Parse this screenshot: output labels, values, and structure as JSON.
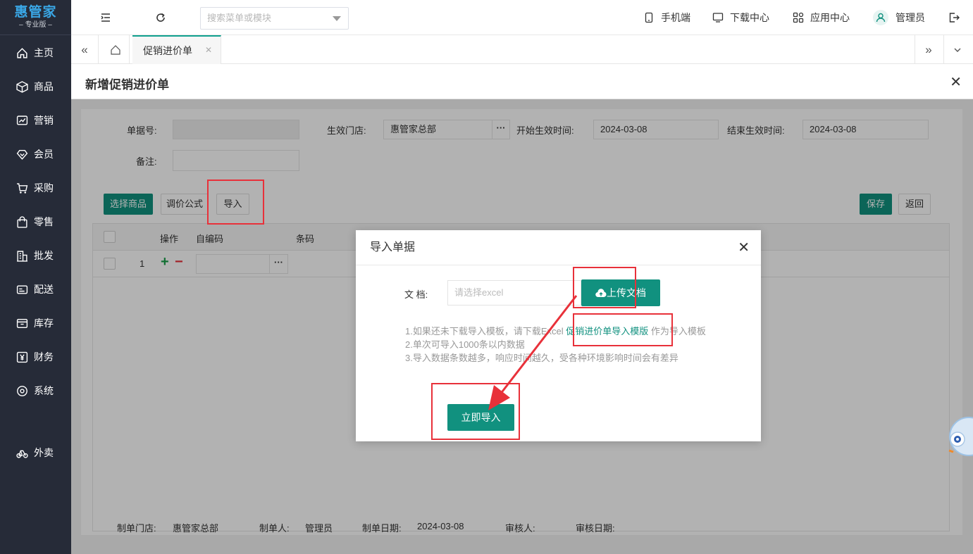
{
  "app": {
    "logo": "惠管家",
    "edition": "专业版"
  },
  "sidebar": {
    "items": [
      {
        "label": "主页"
      },
      {
        "label": "商品"
      },
      {
        "label": "营销"
      },
      {
        "label": "会员"
      },
      {
        "label": "采购"
      },
      {
        "label": "零售"
      },
      {
        "label": "批发"
      },
      {
        "label": "配送"
      },
      {
        "label": "库存"
      },
      {
        "label": "财务"
      },
      {
        "label": "系统"
      },
      {
        "label": "外卖"
      }
    ]
  },
  "topbar": {
    "search_placeholder": "搜索菜单或模块",
    "links": {
      "mobile": "手机端",
      "download": "下载中心",
      "apps": "应用中心",
      "user": "管理员"
    }
  },
  "tabs": {
    "active": "促销进价单"
  },
  "page": {
    "title": "新增促销进价单"
  },
  "form": {
    "doc_no_label": "单据号:",
    "doc_no_value": "",
    "store_label": "生效门店:",
    "store_value": "惠管家总部",
    "start_label": "开始生效时间:",
    "start_value": "2024-03-08",
    "end_label": "结束生效时间:",
    "end_value": "2024-03-08",
    "remark_label": "备注:",
    "remark_value": "",
    "buttons": {
      "select_goods": "选择商品",
      "price_formula": "调价公式",
      "import": "导入",
      "save": "保存",
      "back": "返回"
    },
    "table": {
      "headers": [
        "操作",
        "自编码",
        "条码"
      ],
      "rows": [
        {
          "index": "1"
        }
      ]
    },
    "footer": {
      "store_label": "制单门店:",
      "store_value": "惠管家总部",
      "creator_label": "制单人:",
      "creator_value": "管理员",
      "date_label": "制单日期:",
      "date_value": "2024-03-08",
      "reviewer_label": "审核人:",
      "review_date_label": "审核日期:"
    }
  },
  "modal": {
    "title": "导入单据",
    "doc_label": "文 档:",
    "doc_placeholder": "请选择excel",
    "upload_button": "上传文档",
    "note1_prefix": "1.如果还未下载导入模板，请下载Excel",
    "note1_link": "促销进价单导入模版",
    "note1_suffix": "作为导入模板",
    "note2": "2.单次可导入1000条以内数据",
    "note3": "3.导入数据条数越多，响应时间越久，受各种环境影响时间会有差异",
    "import_button": "立即导入"
  },
  "colors": {
    "sidebar_bg": "#262b38",
    "accent": "#11917f",
    "annotation_red": "#e8313a"
  }
}
